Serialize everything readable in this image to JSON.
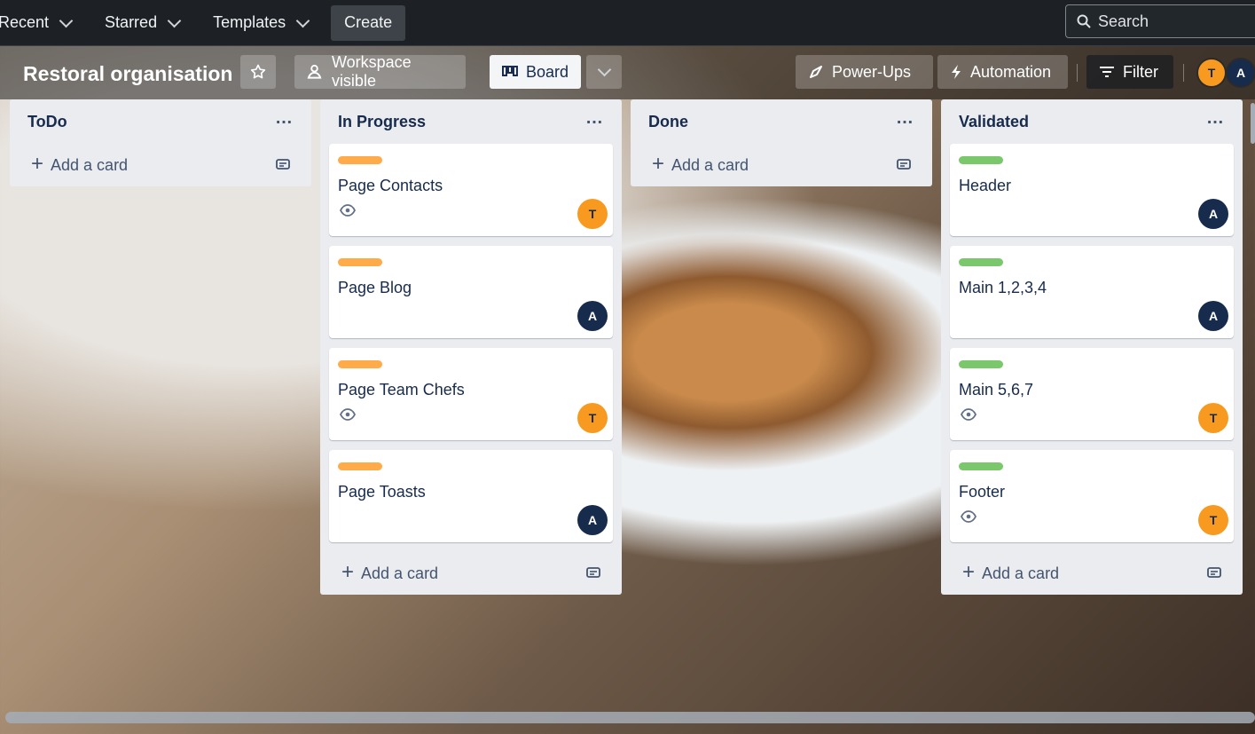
{
  "nav": {
    "items": [
      {
        "label": "Recent"
      },
      {
        "label": "Starred"
      },
      {
        "label": "Templates"
      }
    ],
    "create_label": "Create",
    "search_placeholder": "Search"
  },
  "board": {
    "title": "Restoral organisation",
    "workspace_label": "Workspace visible",
    "view_label": "Board",
    "powerups_label": "Power-Ups",
    "automation_label": "Automation",
    "filter_label": "Filter",
    "members": [
      "T",
      "A"
    ]
  },
  "colors": {
    "label_orange": "#ffab4a",
    "label_green": "#7bc86c",
    "avatar_t": "#f79a1f",
    "avatar_a": "#172b4d"
  },
  "lists": [
    {
      "title": "ToDo",
      "add_label": "Add a card",
      "cards": []
    },
    {
      "title": "In Progress",
      "add_label": "Add a card",
      "cards": [
        {
          "title": "Page Contacts",
          "label": "orange",
          "watch": true,
          "member": "T"
        },
        {
          "title": "Page Blog",
          "label": "orange",
          "watch": false,
          "member": "A"
        },
        {
          "title": "Page Team Chefs",
          "label": "orange",
          "watch": true,
          "member": "T"
        },
        {
          "title": "Page Toasts",
          "label": "orange",
          "watch": false,
          "member": "A"
        }
      ]
    },
    {
      "title": "Done",
      "add_label": "Add a card",
      "cards": []
    },
    {
      "title": "Validated",
      "add_label": "Add a card",
      "cards": [
        {
          "title": "Header",
          "label": "green",
          "watch": false,
          "member": "A"
        },
        {
          "title": "Main 1,2,3,4",
          "label": "green",
          "watch": false,
          "member": "A"
        },
        {
          "title": "Main 5,6,7",
          "label": "green",
          "watch": true,
          "member": "T"
        },
        {
          "title": "Footer",
          "label": "green",
          "watch": true,
          "member": "T"
        }
      ]
    }
  ]
}
